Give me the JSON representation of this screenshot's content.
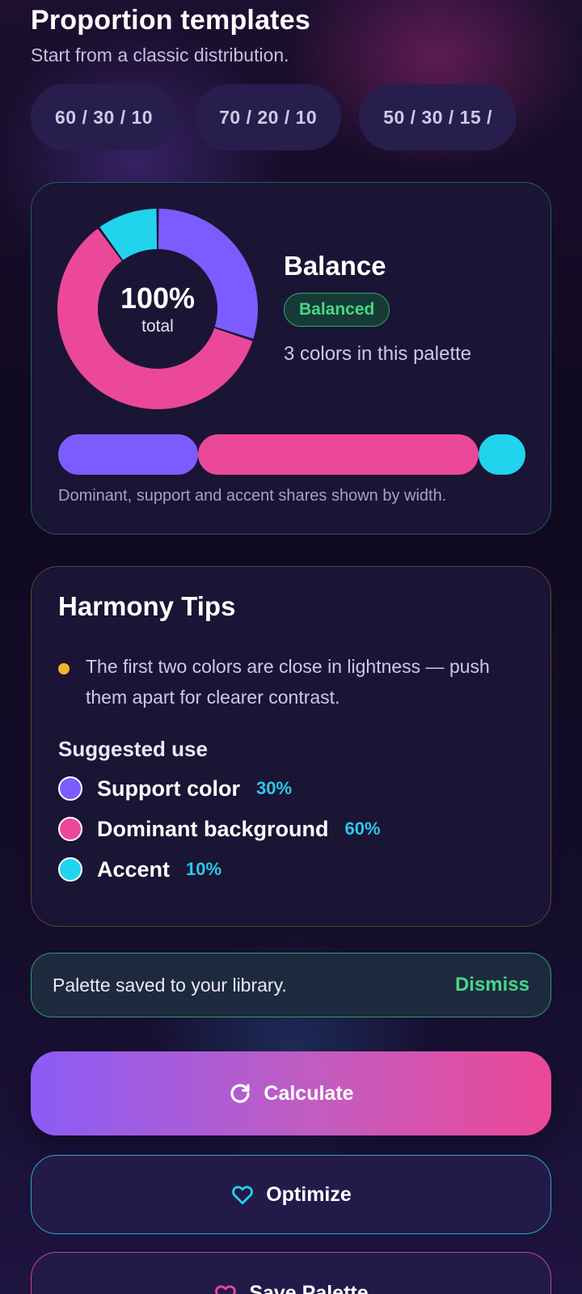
{
  "header": {
    "title": "Proportion templates",
    "subtitle": "Start from a classic distribution."
  },
  "templates": [
    {
      "label": "60 / 30 / 10"
    },
    {
      "label": "70 / 20 / 10"
    },
    {
      "label": "50 / 30 / 15 /"
    }
  ],
  "balance": {
    "total_value": "100%",
    "total_label": "total",
    "title": "Balance",
    "status": "Balanced",
    "count_text": "3 colors in this palette",
    "caption": "Dominant, support and accent shares shown by width.",
    "segments": [
      {
        "name": "Support color",
        "color": "#7c5cff",
        "share": 0.3
      },
      {
        "name": "Dominant background",
        "color": "#ec4899",
        "share": 0.6
      },
      {
        "name": "Accent",
        "color": "#22d3ee",
        "share": 0.1
      }
    ]
  },
  "tips": {
    "title": "Harmony Tips",
    "tip": "The first two colors are close in lightness — push them apart for clearer contrast.",
    "tip_color": "#f2b42a",
    "suggested_title": "Suggested use",
    "usage": [
      {
        "label": "Support color",
        "pct": "30%",
        "color": "#7c5cff"
      },
      {
        "label": "Dominant background",
        "pct": "60%",
        "color": "#ec4899"
      },
      {
        "label": "Accent",
        "pct": "10%",
        "color": "#22d3ee"
      }
    ]
  },
  "toast": {
    "message": "Palette saved to your library.",
    "action": "Dismiss"
  },
  "buttons": {
    "calculate": "Calculate",
    "optimize": "Optimize",
    "save": "Save Palette"
  },
  "icons": {
    "calculate": "refresh-icon",
    "optimize": "heart-outline-icon",
    "save": "heart-outline-icon"
  }
}
